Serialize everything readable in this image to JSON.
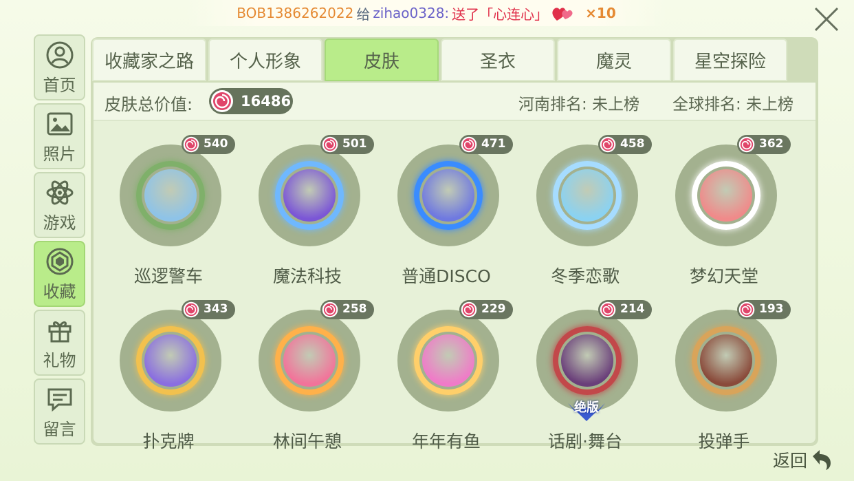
{
  "banner": {
    "sender": "BOB1386262022",
    "give_word": "给",
    "receiver": "zihao0328:",
    "sent_text": "送了「心连心」",
    "count": "×10"
  },
  "sidebar": [
    {
      "label": "首页",
      "icon": "home-icon"
    },
    {
      "label": "照片",
      "icon": "photo-icon"
    },
    {
      "label": "游戏",
      "icon": "atom-icon"
    },
    {
      "label": "收藏",
      "icon": "gem-icon",
      "active": true
    },
    {
      "label": "礼物",
      "icon": "gift-icon"
    },
    {
      "label": "留言",
      "icon": "message-icon"
    }
  ],
  "tabs": [
    {
      "label": "收藏家之路"
    },
    {
      "label": "个人形象"
    },
    {
      "label": "皮肤",
      "active": true
    },
    {
      "label": "圣衣"
    },
    {
      "label": "魔灵"
    },
    {
      "label": "星空探险"
    }
  ],
  "summary": {
    "value_label": "皮肤总价值:",
    "value": "16486",
    "rank_henan": "河南排名: 未上榜",
    "rank_global": "全球排名: 未上榜"
  },
  "skins": [
    {
      "name": "巡逻警车",
      "price": "540",
      "face": "#8ec3e8",
      "ring": "#7fb06a"
    },
    {
      "name": "魔法科技",
      "price": "501",
      "face": "#7b56d6",
      "ring": "#6fb8ff"
    },
    {
      "name": "普通DISCO",
      "price": "471",
      "face": "#6f79e0",
      "ring": "#3a8cff"
    },
    {
      "name": "冬季恋歌",
      "price": "458",
      "face": "#8ad2f2",
      "ring": "#a6dcff"
    },
    {
      "name": "梦幻天堂",
      "price": "362",
      "face": "#f08a8a",
      "ring": "#ffffff"
    },
    {
      "name": "扑克牌",
      "price": "343",
      "face": "#8a6ee0",
      "ring": "#f2c14e"
    },
    {
      "name": "林间午憩",
      "price": "258",
      "face": "#f2739a",
      "ring": "#ffb14a"
    },
    {
      "name": "年年有鱼",
      "price": "229",
      "face": "#f07ac8",
      "ring": "#ffcf6a"
    },
    {
      "name": "话剧·舞台",
      "price": "214",
      "face": "#6a3f7a",
      "ring": "#c2484a",
      "badge": "绝版"
    },
    {
      "name": "投弹手",
      "price": "193",
      "face": "#8a4a3a",
      "ring": "#d9a45a"
    }
  ],
  "back_label": "返回",
  "colors": {
    "active_green": "#b9ec8a",
    "candy_red": "#e0456a"
  }
}
